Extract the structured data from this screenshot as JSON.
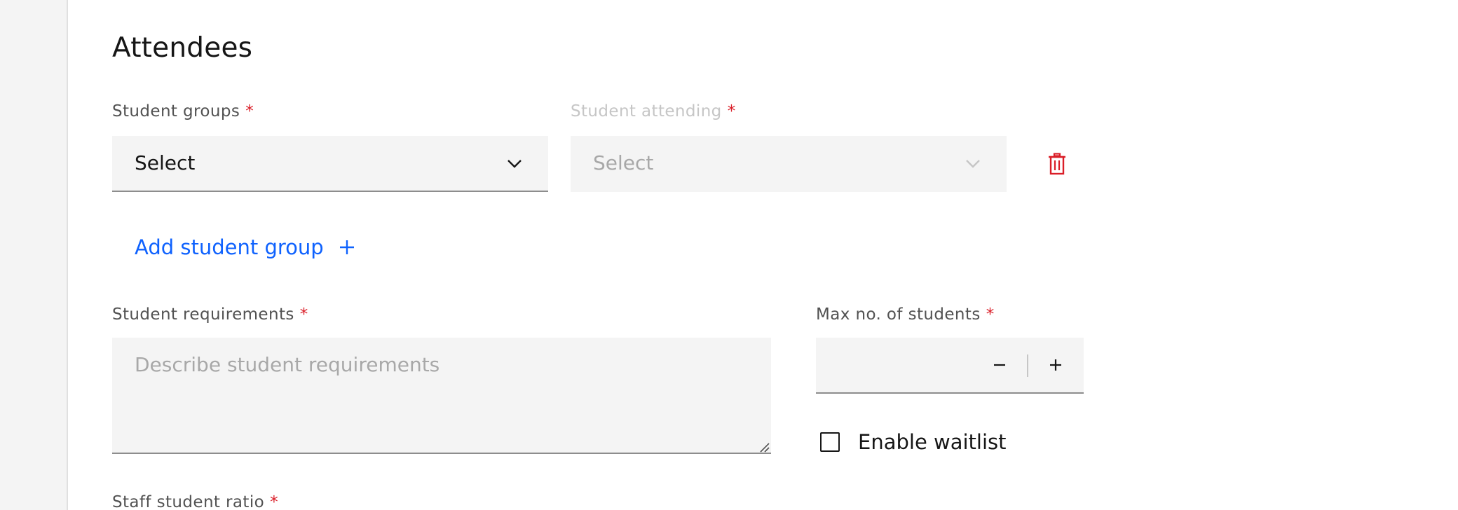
{
  "section": {
    "title": "Attendees"
  },
  "student_groups": {
    "label": "Student groups",
    "required_mark": "*",
    "selected": "Select"
  },
  "student_attending": {
    "label": "Student attending",
    "required_mark": "*",
    "selected": "Select",
    "disabled": true
  },
  "add_group": {
    "label": "Add student group"
  },
  "student_requirements": {
    "label": "Student requirements",
    "required_mark": "*",
    "placeholder": "Describe student requirements",
    "value": ""
  },
  "max_students": {
    "label": "Max no. of students",
    "required_mark": "*",
    "value": ""
  },
  "waitlist": {
    "label": "Enable waitlist",
    "checked": false
  },
  "staff_ratio": {
    "label": "Staff student ratio",
    "required_mark": "*"
  },
  "icons": {
    "select_chevron": "chevron-down-icon",
    "delete": "trash-icon",
    "add": "plus-icon",
    "decrement": "minus-icon",
    "increment": "plus-icon"
  },
  "colors": {
    "accent": "#0f62fe",
    "danger": "#da1e28",
    "field_bg": "#f4f4f4",
    "text_primary": "#161616",
    "text_secondary": "#525252",
    "text_disabled": "#c6c6c6"
  }
}
